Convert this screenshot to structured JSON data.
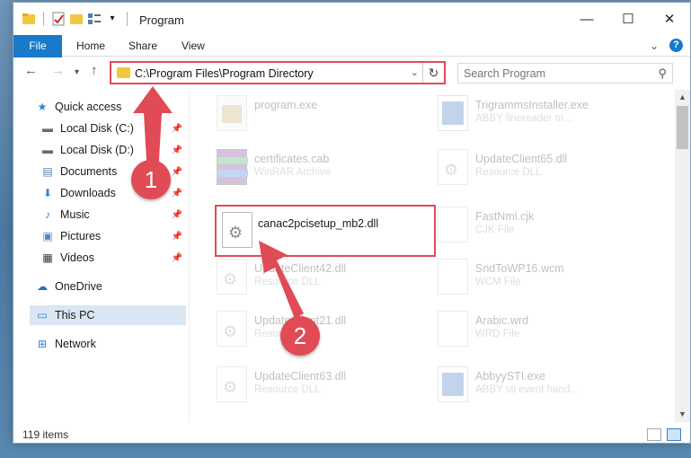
{
  "window": {
    "title": "Program",
    "controls": {
      "minimize": "—",
      "maximize": "☐",
      "close": "✕"
    }
  },
  "ribbon": {
    "tabs": [
      "File",
      "Home",
      "Share",
      "View"
    ],
    "expand": "⌄",
    "help": "?"
  },
  "nav": {
    "back": "←",
    "forward": "→",
    "recent": "▾",
    "up": "↑",
    "address_path": "C:\\Program Files\\Program Directory",
    "dropdown": "⌄",
    "refresh": "↻",
    "search_placeholder": "Search Program",
    "search_icon": "⚲"
  },
  "sidebar": {
    "items": [
      {
        "label": "Quick access",
        "icon": "star-icon",
        "glyph": "★",
        "color": "#2f82d4",
        "pinned": false
      },
      {
        "label": "Local Disk (C:)",
        "icon": "drive-icon",
        "glyph": "▬",
        "color": "#6b6b6b",
        "pinned": true
      },
      {
        "label": "Local Disk (D:)",
        "icon": "drive-icon",
        "glyph": "▬",
        "color": "#6b6b6b",
        "pinned": true
      },
      {
        "label": "Documents",
        "icon": "documents-icon",
        "glyph": "▤",
        "color": "#5a7ea6",
        "pinned": true
      },
      {
        "label": "Downloads",
        "icon": "downloads-icon",
        "glyph": "⬇",
        "color": "#2f82d4",
        "pinned": true
      },
      {
        "label": "Music",
        "icon": "music-icon",
        "glyph": "♪",
        "color": "#2f82d4",
        "pinned": true
      },
      {
        "label": "Pictures",
        "icon": "pictures-icon",
        "glyph": "▣",
        "color": "#4a86c8",
        "pinned": true
      },
      {
        "label": "Videos",
        "icon": "videos-icon",
        "glyph": "▦",
        "color": "#333",
        "pinned": true
      },
      {
        "label": "OneDrive",
        "icon": "onedrive-icon",
        "glyph": "☁",
        "color": "#1f6fc4",
        "pinned": false
      },
      {
        "label": "This PC",
        "icon": "computer-icon",
        "glyph": "▭",
        "color": "#2f82d4",
        "pinned": false,
        "selected": true
      },
      {
        "label": "Network",
        "icon": "network-icon",
        "glyph": "⊞",
        "color": "#2f82d4",
        "pinned": false
      }
    ]
  },
  "files": [
    {
      "name": "program.exe",
      "type": "",
      "icon": "exe-icon",
      "faded": true
    },
    {
      "name": "TrigrammsInstaller.exe",
      "type": "ABBY finereader tri...",
      "icon": "installer-icon",
      "faded": true
    },
    {
      "name": "certificates.cab",
      "type": "WinRAR Archive",
      "icon": "archive-icon",
      "faded": true
    },
    {
      "name": "UpdateClient65.dll",
      "type": "Resource DLL",
      "icon": "dll-icon",
      "faded": true
    },
    {
      "name": "canac2pcisetup_mb2.dll",
      "type": "",
      "icon": "dll-icon",
      "faded": false,
      "highlighted": true
    },
    {
      "name": "FastNml.cjk",
      "type": "CJK File",
      "icon": "file-icon",
      "faded": true
    },
    {
      "name": "UpdateClient42.dll",
      "type": "Resource DLL",
      "icon": "dll-icon",
      "faded": true
    },
    {
      "name": "SndToWP16.wcm",
      "type": "WCM File",
      "icon": "file-icon",
      "faded": true
    },
    {
      "name": "UpdateClient21.dll",
      "type": "Resource DLL",
      "icon": "dll-icon",
      "faded": true
    },
    {
      "name": "Arabic.wrd",
      "type": "WRD File",
      "icon": "file-icon",
      "faded": true
    },
    {
      "name": "UpdateClient63.dll",
      "type": "Resource DLL",
      "icon": "dll-icon",
      "faded": true
    },
    {
      "name": "AbbyySTI.exe",
      "type": "ABBY sti event hand...",
      "icon": "installer-icon",
      "faded": true
    }
  ],
  "status": {
    "item_count": "119 items"
  },
  "annotations": {
    "step1": "1",
    "step2": "2",
    "color": "#e04b55"
  }
}
